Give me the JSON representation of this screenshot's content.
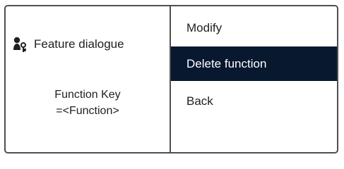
{
  "dialog": {
    "title": "Feature dialogue",
    "title_icon": "person-key-icon",
    "function_key_label": "Function Key",
    "function_key_value": "=<Function>"
  },
  "menu": {
    "items": [
      {
        "label": "Modify",
        "selected": false
      },
      {
        "label": "Delete function",
        "selected": true
      },
      {
        "label": "Back",
        "selected": false
      }
    ],
    "selected_background": "#07182f",
    "selected_text_color": "#ffffff"
  }
}
